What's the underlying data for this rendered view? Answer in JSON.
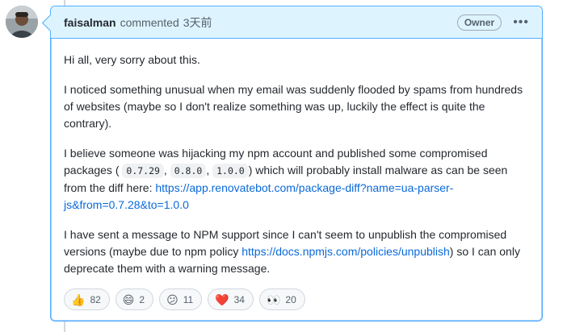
{
  "comment": {
    "author": "faisalman",
    "action": "commented",
    "timestamp": "3天前",
    "role_badge": "Owner",
    "menu_icon": "kebab-horizontal-icon",
    "paragraphs": {
      "p1": "Hi all, very sorry about this.",
      "p2": "I noticed something unusual when my email was suddenly flooded by spams from hundreds of websites (maybe so I don't realize something was up, luckily the effect is quite the contrary).",
      "p3_pre": "I believe someone was hijacking my npm account and published some compromised packages (",
      "p3_sep1": ",",
      "p3_sep2": ",",
      "p3_mid": ") which will probably install malware as can be seen from the diff here:",
      "p4_pre": "I have sent a message to NPM support since I can't seem to unpublish the compromised versions (maybe due to npm policy",
      "p4_post": ") so I can only deprecate them with a warning message."
    },
    "versions": [
      "0.7.29",
      "0.8.0",
      "1.0.0"
    ],
    "links": {
      "diff": "https://app.renovatebot.com/package-diff?name=ua-parser-js&from=0.7.28&to=1.0.0",
      "policy": "https://docs.npmjs.com/policies/unpublish"
    }
  },
  "reactions": [
    {
      "emoji": "👍",
      "icon": "thumbs-up-icon",
      "count": "82"
    },
    {
      "emoji": "😄",
      "icon": "laugh-icon",
      "count": "2"
    },
    {
      "emoji": "😕",
      "icon": "confused-icon",
      "count": "11"
    },
    {
      "emoji": "❤️",
      "icon": "heart-icon",
      "count": "34"
    },
    {
      "emoji": "👀",
      "icon": "eyes-icon",
      "count": "20"
    }
  ],
  "colors": {
    "header_bg": "#ddf4ff",
    "border": "#54aeff",
    "link": "#0969da"
  }
}
